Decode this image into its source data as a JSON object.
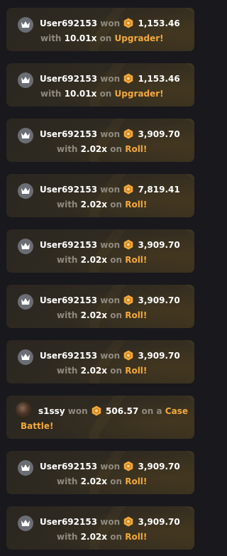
{
  "feed": {
    "items": [
      {
        "user": "User692153",
        "won": "won",
        "amount": "1,153.46",
        "with": "with",
        "multiplier": "10.01x",
        "on": "on",
        "game": "Upgrader!"
      },
      {
        "user": "User692153",
        "won": "won",
        "amount": "1,153.46",
        "with": "with",
        "multiplier": "10.01x",
        "on": "on",
        "game": "Upgrader!"
      },
      {
        "user": "User692153",
        "won": "won",
        "amount": "3,909.70",
        "with": "with",
        "multiplier": "2.02x",
        "on": "on",
        "game": "Roll!"
      },
      {
        "user": "User692153",
        "won": "won",
        "amount": "7,819.41",
        "with": "with",
        "multiplier": "2.02x",
        "on": "on",
        "game": "Roll!"
      },
      {
        "user": "User692153",
        "won": "won",
        "amount": "3,909.70",
        "with": "with",
        "multiplier": "2.02x",
        "on": "on",
        "game": "Roll!"
      },
      {
        "user": "User692153",
        "won": "won",
        "amount": "3,909.70",
        "with": "with",
        "multiplier": "2.02x",
        "on": "on",
        "game": "Roll!"
      },
      {
        "user": "User692153",
        "won": "won",
        "amount": "3,909.70",
        "with": "with",
        "multiplier": "2.02x",
        "on": "on",
        "game": "Roll!"
      },
      {
        "user": "s1ssy",
        "won": "won",
        "amount": "506.57",
        "on": "on a",
        "game_line1": "Case",
        "game_line2": "Battle!"
      },
      {
        "user": "User692153",
        "won": "won",
        "amount": "3,909.70",
        "with": "with",
        "multiplier": "2.02x",
        "on": "on",
        "game": "Roll!"
      },
      {
        "user": "User692153",
        "won": "won",
        "amount": "3,909.70",
        "with": "with",
        "multiplier": "2.02x",
        "on": "on",
        "game": "Roll!"
      }
    ]
  },
  "icons": {
    "avatar_default": "crown-icon",
    "coin": "coin-icon",
    "avatar_photo": "user-photo-avatar"
  },
  "colors": {
    "background": "#18181d",
    "card": "#2f2a21",
    "username": "#ffffff",
    "muted": "#8f8a80",
    "accent": "#f3a93b",
    "coin": "#f2a93b"
  }
}
